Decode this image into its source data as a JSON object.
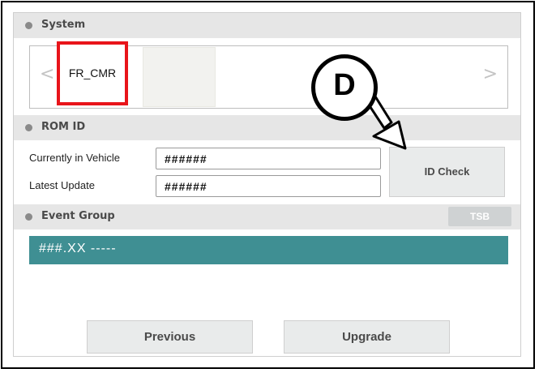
{
  "system": {
    "header": "System",
    "selected_item": "FR_CMR",
    "prev_icon": "chevron-left-icon",
    "next_icon": "chevron-right-icon"
  },
  "rom_id": {
    "header": "ROM ID",
    "current_label": "Currently in Vehicle",
    "current_value": "######",
    "latest_label": "Latest Update",
    "latest_value": "######",
    "id_check_label": "ID Check"
  },
  "event_group": {
    "header": "Event Group",
    "tsb_label": "TSB",
    "items": [
      "###.XX -----"
    ]
  },
  "footer": {
    "previous_label": "Previous",
    "upgrade_label": "Upgrade"
  },
  "callout": {
    "letter": "D"
  },
  "colors": {
    "highlight": "#e8141a",
    "event_row": "#3f8f93",
    "header_bg": "#e6e6e6"
  }
}
